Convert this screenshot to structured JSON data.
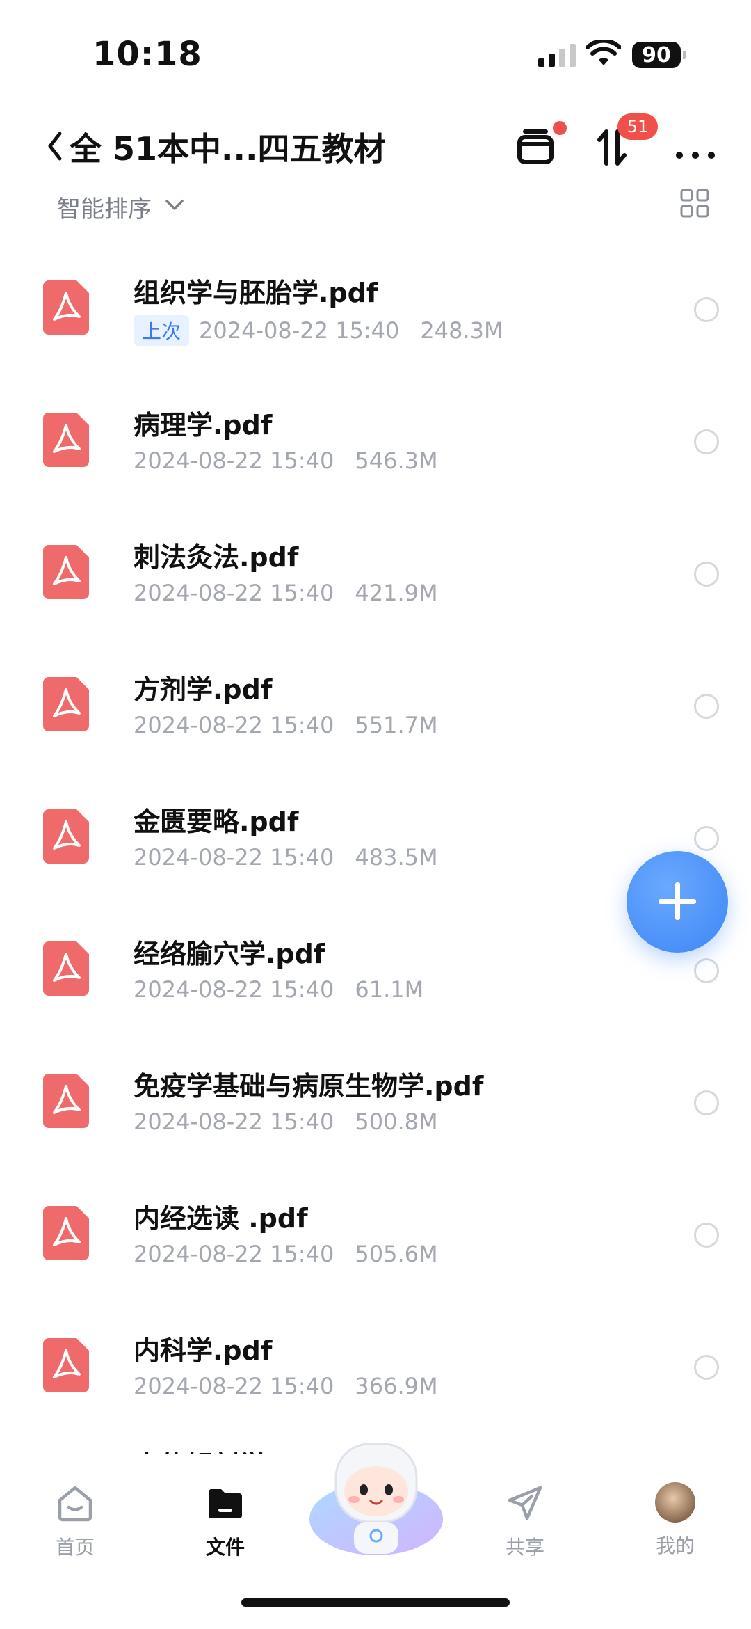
{
  "status": {
    "time": "10:18",
    "battery": "90"
  },
  "header": {
    "title": "全 51本中...四五教材",
    "transfer_badge": "51"
  },
  "sort": {
    "label": "智能排序"
  },
  "files": [
    {
      "name": "组织学与胚胎学.pdf",
      "tag": "上次",
      "date": "2024-08-22 15:40",
      "size": "248.3M"
    },
    {
      "name": "病理学.pdf",
      "tag": "",
      "date": "2024-08-22 15:40",
      "size": "546.3M"
    },
    {
      "name": "刺法灸法.pdf",
      "tag": "",
      "date": "2024-08-22 15:40",
      "size": "421.9M"
    },
    {
      "name": "方剂学.pdf",
      "tag": "",
      "date": "2024-08-22 15:40",
      "size": "551.7M"
    },
    {
      "name": "金匮要略.pdf",
      "tag": "",
      "date": "2024-08-22 15:40",
      "size": "483.5M"
    },
    {
      "name": "经络腧穴学.pdf",
      "tag": "",
      "date": "2024-08-22 15:40",
      "size": "61.1M"
    },
    {
      "name": "免疫学基础与病原生物学.pdf",
      "tag": "",
      "date": "2024-08-22 15:40",
      "size": "500.8M"
    },
    {
      "name": "内经选读 .pdf",
      "tag": "",
      "date": "2024-08-22 15:40",
      "size": "505.6M"
    },
    {
      "name": "内科学.pdf",
      "tag": "",
      "date": "2024-08-22 15:40",
      "size": "366.9M"
    }
  ],
  "partial_file": {
    "name": "人体解剖学.pdf"
  },
  "tabbar": {
    "home": "首页",
    "files": "文件",
    "share": "共享",
    "mine": "我的"
  },
  "colors": {
    "accent": "#3d86f5",
    "pdf_red": "#ef6b6b",
    "badge": "#f0504a",
    "meta_gray": "#a3a7b0"
  }
}
